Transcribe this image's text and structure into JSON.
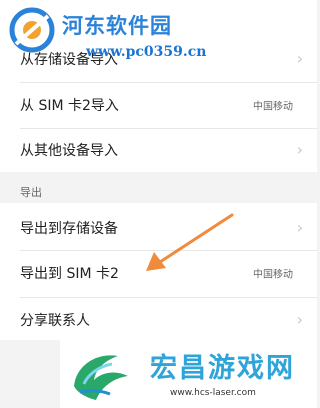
{
  "watermark_top": {
    "brand": "河东软件园",
    "url": "www.pc0359.cn"
  },
  "import_section": {
    "rows": [
      {
        "label": "从存储设备导入",
        "value": "",
        "chevron": "›"
      },
      {
        "label": "从 SIM 卡2导入",
        "value": "中国移动",
        "chevron": ""
      },
      {
        "label": "从其他设备导入",
        "value": "",
        "chevron": "›"
      }
    ]
  },
  "export_section": {
    "header": "导出",
    "rows": [
      {
        "label": "导出到存储设备",
        "value": "",
        "chevron": "›"
      },
      {
        "label": "导出到 SIM 卡2",
        "value": "中国移动",
        "chevron": ""
      },
      {
        "label": "分享联系人",
        "value": "",
        "chevron": "›"
      }
    ]
  },
  "annotation": {
    "arrow_color": "#f08a3c"
  },
  "watermark_bottom": {
    "brand": "宏昌游戏网",
    "url": "www.hcs-laser.com"
  }
}
